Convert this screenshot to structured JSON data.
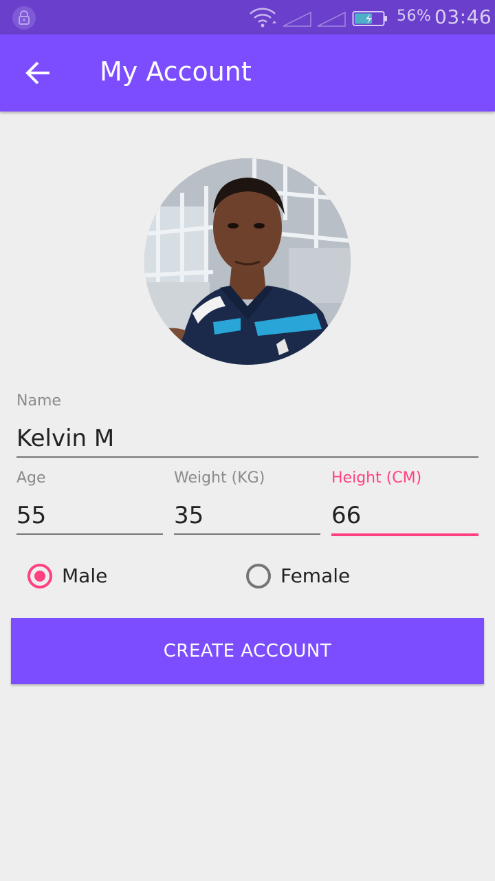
{
  "status_bar": {
    "battery_percent": "56%",
    "time": "03:46",
    "icons": [
      "lock-icon",
      "wifi-icon",
      "signal-icon",
      "signal-icon",
      "battery-charging-icon"
    ]
  },
  "app_bar": {
    "title": "My Account",
    "back_icon": "arrow-back-icon",
    "color": "#7c4dff"
  },
  "profile": {
    "avatar": "profile-photo"
  },
  "form": {
    "name": {
      "label": "Name",
      "value": "Kelvin M"
    },
    "age": {
      "label": "Age",
      "value": "55"
    },
    "weight": {
      "label": "Weight (KG)",
      "value": "35"
    },
    "height": {
      "label": "Height (CM)",
      "value": "66"
    },
    "gender": {
      "options": [
        {
          "label": "Male",
          "selected": true
        },
        {
          "label": "Female",
          "selected": false
        }
      ]
    },
    "accent_color": "#ff4081"
  },
  "actions": {
    "create_label": "CREATE ACCOUNT"
  }
}
